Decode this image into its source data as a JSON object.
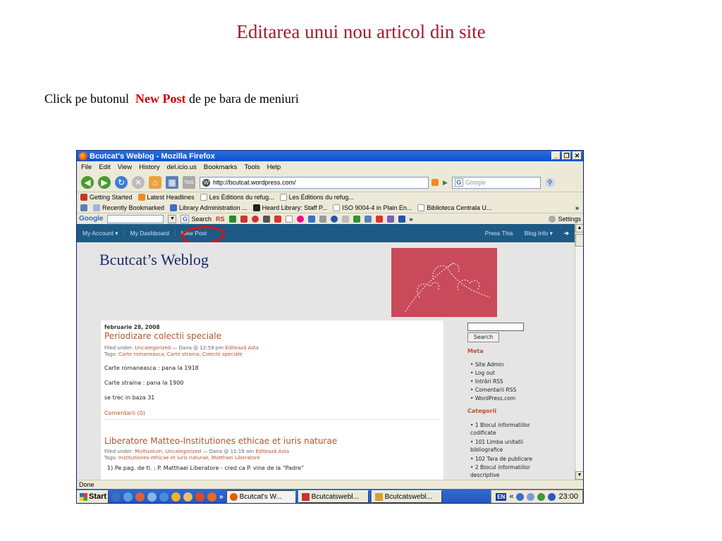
{
  "slide": {
    "title": "Editarea unui nou articol din site",
    "instruction_prefix": "Click pe butonul",
    "instruction_highlight": "New Post",
    "instruction_suffix": "de pe bara de meniuri",
    "highlight_color": "#d40000",
    "title_color": "#a6192e"
  },
  "browser": {
    "window_title": "Bcutcat's Weblog - Mozilla Firefox",
    "menu": [
      "File",
      "Edit",
      "View",
      "History",
      "del.icio.us",
      "Bookmarks",
      "Tools",
      "Help"
    ],
    "url": "http://bcutcat.wordpress.com/",
    "search_placeholder": "Google",
    "bookmarks_row1": [
      "Getting Started",
      "Latest Headlines",
      "Les Éditions du refug...",
      "Les Éditions du refug..."
    ],
    "bookmarks_row2": [
      "Recently Bookmarked",
      "Library Administration ...",
      "Heard Library: Staff P...",
      "ISO 9004-4 in Plain En...",
      "Biblioteca Centrala U..."
    ],
    "bookmarks_more": "»",
    "google_toolbar": {
      "logo": "Google",
      "search_label": "Search",
      "rs_label": "RS",
      "settings_label": "Settings"
    },
    "status": "Done"
  },
  "wp_admin_bar": {
    "my_account": "My Account ▾",
    "my_dashboard": "My Dashboard",
    "new_post": "New Post",
    "press_this": "Press This",
    "blog_info": "Blog Info ▾"
  },
  "blog": {
    "title": "Bcutcat’s Weblog",
    "posts": [
      {
        "date": "februarie 28, 2008",
        "title": "Periodizare colectii speciale",
        "meta_filed": "Filed under: ",
        "meta_cats": "Uncategorized",
        "meta_author": " — Dana @ 12:59 pm ",
        "meta_edit": "Editează Asta",
        "meta_tags_label": "Tags: ",
        "meta_tags": "Carte romaneasca, Carte straina, Colectii speciale",
        "body": [
          "Carte romaneasca : pana la 1918",
          "Carte straina : pana la 1900",
          "se trec in baza 31"
        ],
        "comments": "Comentarii (0)"
      },
      {
        "title": "Liberatore Matteo-Institutiones ethicae et iuris naturae",
        "meta_filed": "Filed under: ",
        "meta_cats": "Multivolum, Uncategorized",
        "meta_author": " — Dana @ 11:19 am ",
        "meta_edit": "Editează Asta",
        "meta_tags_label": "Tags: ",
        "meta_tags": "Institutiones ethicae et iuris naturae, Matthaei Liberatore",
        "body": [
          "1) Pe pag. de tl. : P. Matthaei Liberatore - cred ca P. vine de la “Padre”"
        ]
      }
    ],
    "sidebar": {
      "search_button": "Search",
      "meta_heading": "Meta",
      "meta_items": [
        "Site Admin",
        "Log out",
        "Intrări RSS",
        "Comentarii RSS",
        "WordPress.com"
      ],
      "categories_heading": "Categorii",
      "categories": [
        "1 Blocul informatiilor codificate",
        "101 Limba unitatii bibliografice",
        "102 Tara de publicare",
        "2 Blocul informatiilor descriptive"
      ]
    }
  },
  "taskbar": {
    "start": "Start",
    "more": "»",
    "tasks": [
      "Bcutcat's W...",
      "Bcutcatswebl...",
      "Bcutcatswebl..."
    ],
    "lang": "EN",
    "tray_more": "«",
    "clock": "23:00"
  },
  "colors": {
    "wp_bar": "#1e5a86",
    "post_title": "#b5542a",
    "blog_title": "#1a2a6b",
    "taskbar": "#2456c0"
  }
}
